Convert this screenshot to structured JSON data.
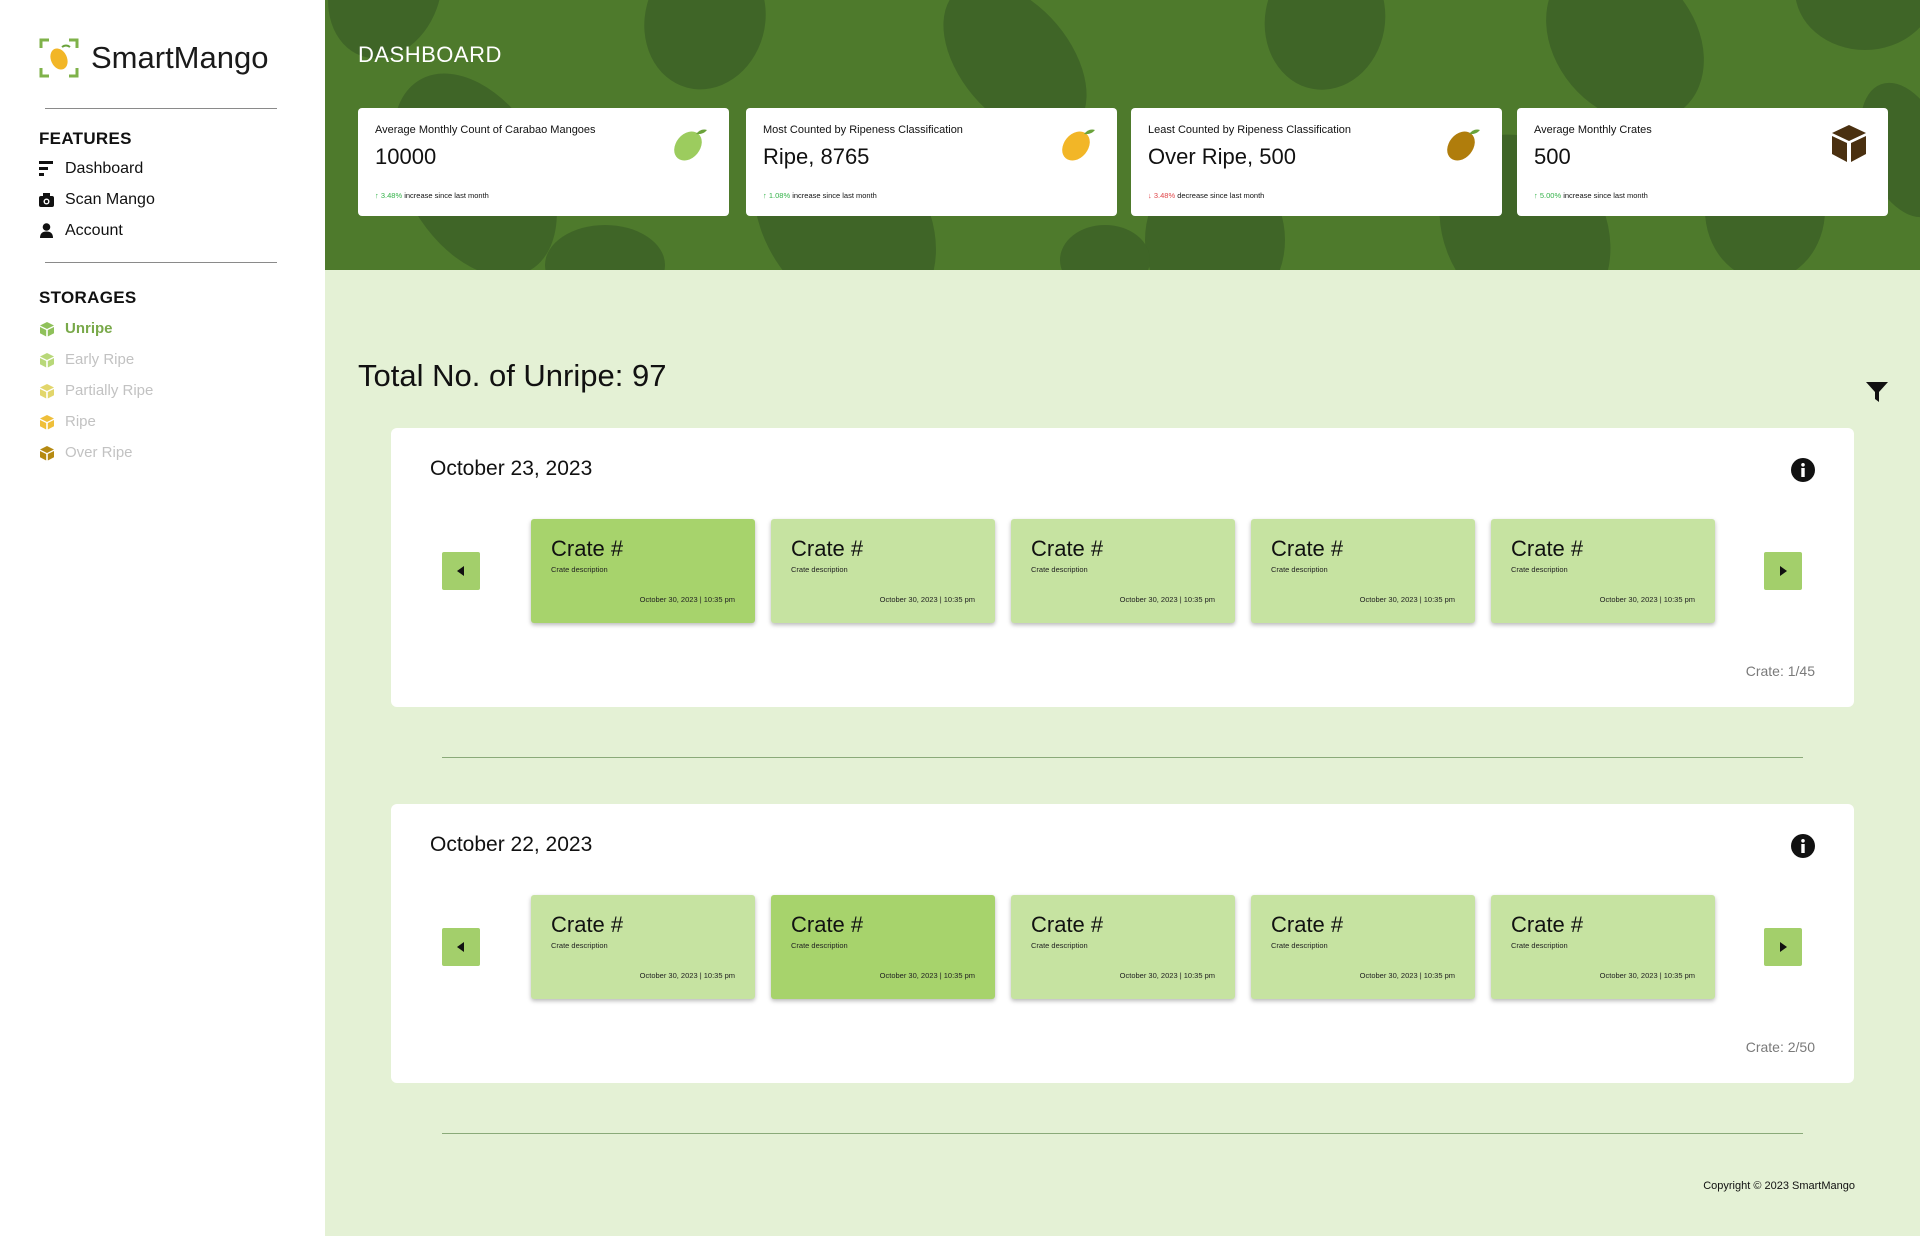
{
  "app": {
    "name": "SmartMango"
  },
  "sidebar": {
    "features_title": "FEATURES",
    "features": [
      {
        "label": "Dashboard",
        "icon": "dashboard-icon"
      },
      {
        "label": "Scan Mango",
        "icon": "camera-icon"
      },
      {
        "label": "Account",
        "icon": "user-icon"
      }
    ],
    "storages_title": "STORAGES",
    "storages": [
      {
        "label": "Unripe",
        "color": "#8fc15a",
        "text_color": "#79a94a",
        "active": true
      },
      {
        "label": "Early Ripe",
        "color": "#b8d879",
        "text_color": "#c2c2c2",
        "active": false
      },
      {
        "label": "Partially Ripe",
        "color": "#e2d66b",
        "text_color": "#c2c2c2",
        "active": false
      },
      {
        "label": "Ripe",
        "color": "#efbf3a",
        "text_color": "#c2c2c2",
        "active": false
      },
      {
        "label": "Over Ripe",
        "color": "#b58a12",
        "text_color": "#c2c2c2",
        "active": false
      }
    ]
  },
  "header": {
    "title": "DASHBOARD",
    "stats": [
      {
        "label": "Average Monthly Count of Carabao Mangoes",
        "value": "10000",
        "trend_value": "3.48%",
        "trend_dir": "up",
        "trend_text": "increase since last month",
        "icon": "mango-unripe-icon",
        "icon_color": "#9ccc5e"
      },
      {
        "label": "Most Counted by Ripeness Classification",
        "value": "Ripe, 8765",
        "trend_value": "1.08%",
        "trend_dir": "up",
        "trend_text": "increase since last month",
        "icon": "mango-ripe-icon",
        "icon_color": "#f2b627"
      },
      {
        "label": "Least Counted by Ripeness Classification",
        "value": "Over Ripe, 500",
        "trend_value": "3.48%",
        "trend_dir": "down",
        "trend_text": "decrease since last month",
        "icon": "mango-overripe-icon",
        "icon_color": "#b07d0c"
      },
      {
        "label": "Average Monthly Crates",
        "value": "500",
        "trend_value": "5.00%",
        "trend_dir": "up",
        "trend_text": "increase since last month",
        "icon": "crate-box-icon",
        "icon_color": "#4a3010"
      }
    ]
  },
  "main": {
    "total_title": "Total No. of Unripe: 97",
    "days": [
      {
        "date": "October 23, 2023",
        "crate_count": "Crate: 1/45",
        "active_index": 0,
        "crates": [
          {
            "title": "Crate #",
            "description": "Crate description",
            "date": "October 30, 2023 | 10:35 pm"
          },
          {
            "title": "Crate #",
            "description": "Crate description",
            "date": "October 30, 2023 | 10:35 pm"
          },
          {
            "title": "Crate #",
            "description": "Crate description",
            "date": "October 30, 2023 | 10:35 pm"
          },
          {
            "title": "Crate #",
            "description": "Crate description",
            "date": "October 30, 2023 | 10:35 pm"
          },
          {
            "title": "Crate #",
            "description": "Crate description",
            "date": "October 30, 2023 | 10:35 pm"
          }
        ]
      },
      {
        "date": "October 22, 2023",
        "crate_count": "Crate: 2/50",
        "active_index": 1,
        "crates": [
          {
            "title": "Crate #",
            "description": "Crate description",
            "date": "October 30, 2023 | 10:35 pm"
          },
          {
            "title": "Crate #",
            "description": "Crate description",
            "date": "October 30, 2023 | 10:35 pm"
          },
          {
            "title": "Crate #",
            "description": "Crate description",
            "date": "October 30, 2023 | 10:35 pm"
          },
          {
            "title": "Crate #",
            "description": "Crate description",
            "date": "October 30, 2023 | 10:35 pm"
          },
          {
            "title": "Crate #",
            "description": "Crate description",
            "date": "October 30, 2023 | 10:35 pm"
          }
        ]
      }
    ]
  },
  "footer": {
    "copyright": "Copyright © 2023 SmartMango"
  }
}
